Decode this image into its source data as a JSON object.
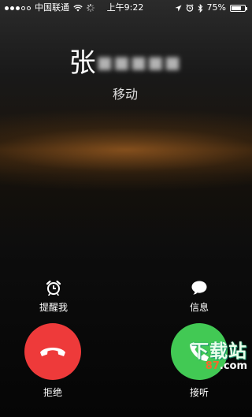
{
  "status_bar": {
    "signal_dots_filled": 3,
    "signal_dots_total": 5,
    "carrier": "中国联通",
    "time": "上午9:22",
    "battery": "75%",
    "battery_level": 0.75,
    "icons": [
      "signal-dots-icon",
      "wifi-icon",
      "loading-icon",
      "location-arrow-icon",
      "alarm-icon",
      "bluetooth-icon",
      "battery-icon"
    ]
  },
  "caller": {
    "name_visible": "张",
    "name_obscured": "■■■■■",
    "location": "移动"
  },
  "options": {
    "remind_label": "提醒我",
    "message_label": "信息",
    "icons": [
      "alarm-clock-icon",
      "chat-bubble-icon"
    ]
  },
  "actions": {
    "decline_label": "拒绝",
    "accept_label": "接听",
    "decline_color": "#ee3a3a",
    "accept_color": "#42c954",
    "icons": [
      "phone-hangup-icon",
      "phone-icon"
    ]
  },
  "watermark": {
    "main": "下载站",
    "sub_prefix": "",
    "sub_highlight": "87",
    "sub_suffix": ".com"
  }
}
